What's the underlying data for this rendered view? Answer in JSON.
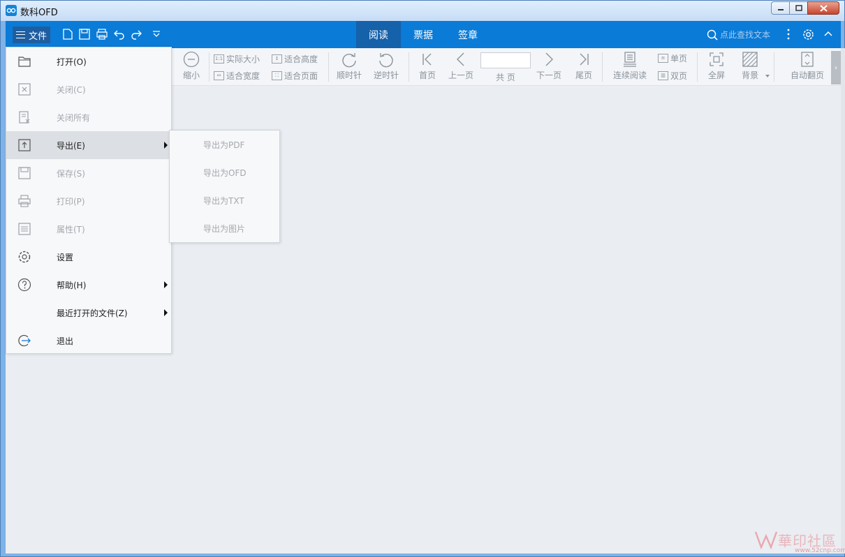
{
  "window": {
    "title": "数科OFD"
  },
  "topbar": {
    "menu_label": "文件",
    "tabs": [
      {
        "label": "阅读",
        "active": true
      },
      {
        "label": "票据",
        "active": false
      },
      {
        "label": "签章",
        "active": false
      }
    ],
    "search_placeholder": "点此查找文本",
    "colors": {
      "bar": "#0a7bd7",
      "active_tab": "#1561aa"
    }
  },
  "ribbon": {
    "zoom_out": "缩小",
    "actual_size": "实际大小",
    "fit_height": "适合高度",
    "fit_width": "适合宽度",
    "fit_page": "适合页面",
    "rotate_cw": "顺时针",
    "rotate_ccw": "逆时针",
    "first_page": "首页",
    "prev_page": "上一页",
    "total_pages": "共  页",
    "next_page": "下一页",
    "last_page": "尾页",
    "continuous": "连续阅读",
    "single_page": "单页",
    "double_page": "双页",
    "fullscreen": "全屏",
    "background": "背景",
    "auto_flip": "自动翻页"
  },
  "file_menu": {
    "items": [
      {
        "label": "打开(O)",
        "icon": "folder-icon",
        "disabled": false
      },
      {
        "label": "关闭(C)",
        "icon": "close-doc-icon",
        "disabled": true
      },
      {
        "label": "关闭所有",
        "icon": "close-all-icon",
        "disabled": true
      },
      {
        "label": "导出(E)",
        "icon": "export-icon",
        "disabled": false,
        "submenu": true
      },
      {
        "label": "保存(S)",
        "icon": "save-icon",
        "disabled": true
      },
      {
        "label": "打印(P)",
        "icon": "print-icon",
        "disabled": true
      },
      {
        "label": "属性(T)",
        "icon": "properties-icon",
        "disabled": true
      },
      {
        "label": "设置",
        "icon": "gear-icon",
        "disabled": false
      },
      {
        "label": "帮助(H)",
        "icon": "help-icon",
        "disabled": false,
        "submenu": true
      },
      {
        "label": "最近打开的文件(Z)",
        "icon": "",
        "disabled": false,
        "submenu": true
      },
      {
        "label": "退出",
        "icon": "exit-icon",
        "disabled": false
      }
    ]
  },
  "export_menu": {
    "items": [
      {
        "label": "导出为PDF"
      },
      {
        "label": "导出为OFD"
      },
      {
        "label": "导出为TXT"
      },
      {
        "label": "导出为图片"
      }
    ]
  },
  "watermark": {
    "text": "華印社區",
    "url": "www.52cnp.com"
  }
}
